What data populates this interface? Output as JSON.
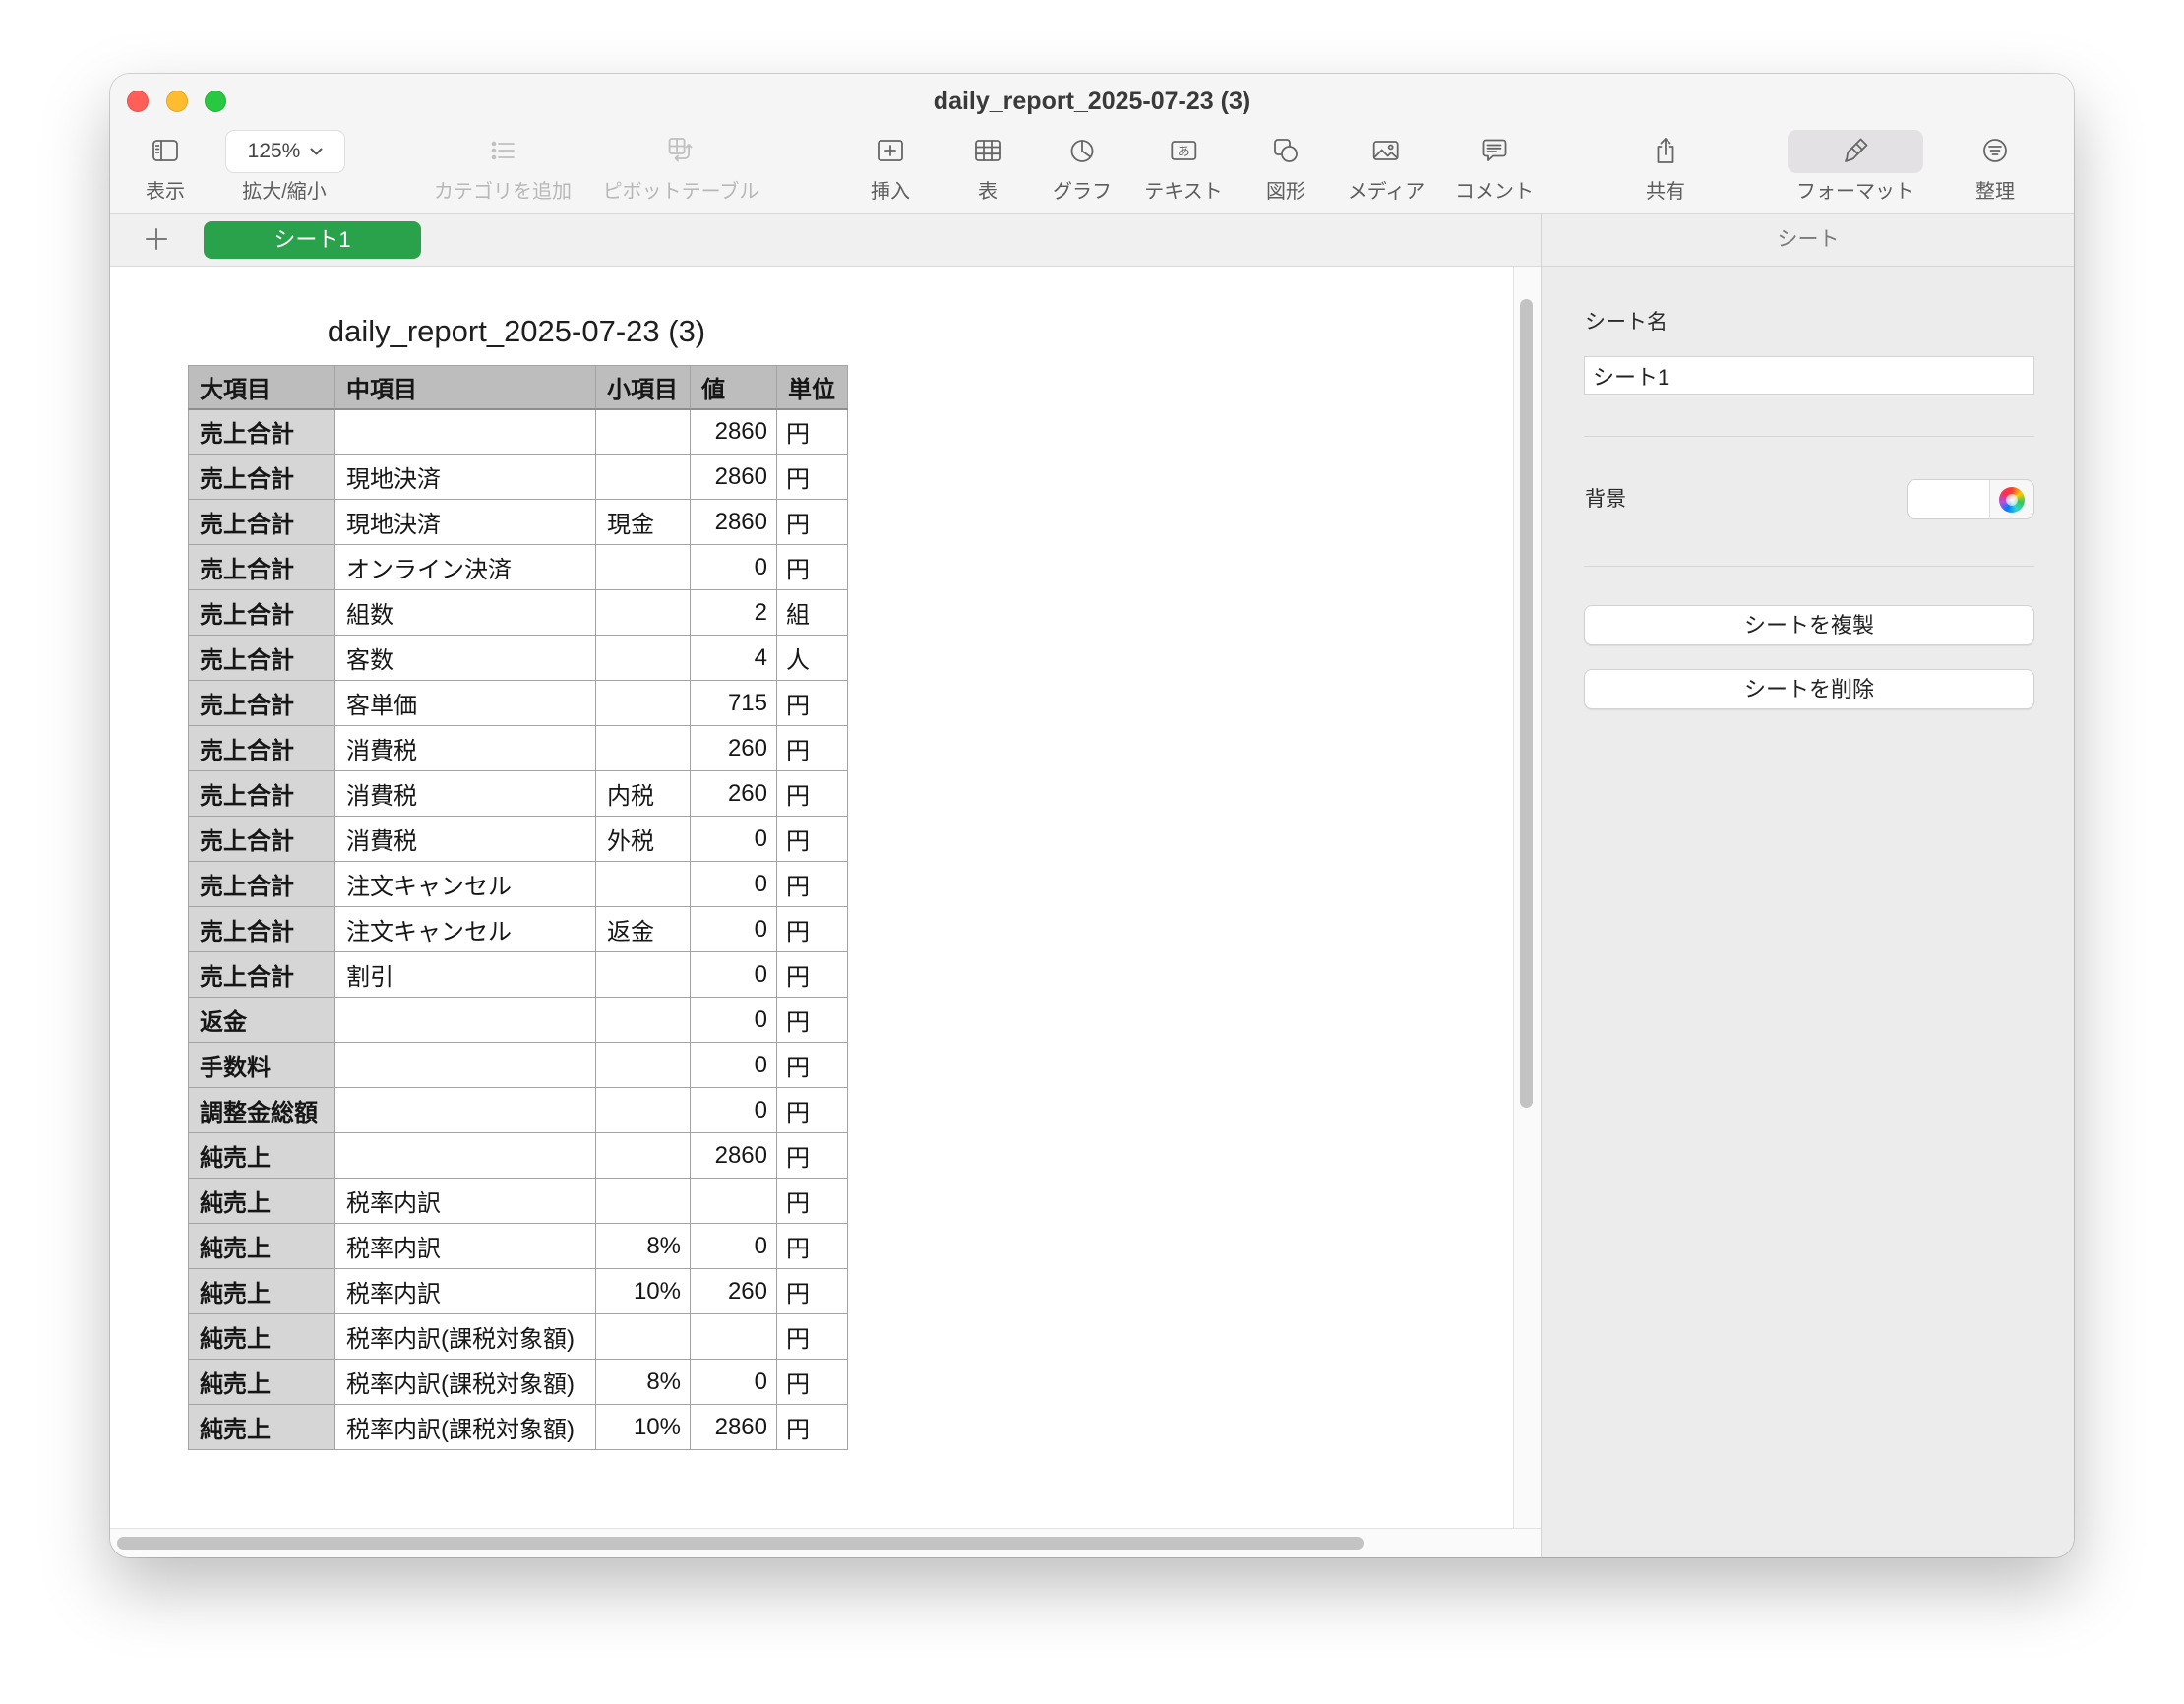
{
  "window": {
    "title": "daily_report_2025-07-23 (3)",
    "traffic_light_colors": {
      "close": "#ff5f57",
      "minimize": "#febc2e",
      "zoom": "#28c840"
    }
  },
  "toolbar": {
    "view": {
      "label": "表示",
      "icon": "sidebar-icon"
    },
    "zoom": {
      "value": "125%",
      "label": "拡大/縮小",
      "icon": "chevron-down-icon"
    },
    "add_category": {
      "label": "カテゴリを追加",
      "icon": "list-icon",
      "enabled": false
    },
    "pivot_table": {
      "label": "ピボットテーブル",
      "icon": "pivot-table-icon",
      "enabled": false
    },
    "insert": {
      "label": "挿入",
      "icon": "insert-icon"
    },
    "table": {
      "label": "表",
      "icon": "table-icon"
    },
    "chart": {
      "label": "グラフ",
      "icon": "chart-icon"
    },
    "text": {
      "label": "テキスト",
      "icon": "text-box-icon",
      "icon_glyph": "あ"
    },
    "shape": {
      "label": "図形",
      "icon": "shape-icon"
    },
    "media": {
      "label": "メディア",
      "icon": "media-icon"
    },
    "comment": {
      "label": "コメント",
      "icon": "comment-icon"
    },
    "share": {
      "label": "共有",
      "icon": "share-icon"
    },
    "format": {
      "label": "フォーマット",
      "icon": "paintbrush-icon",
      "selected": true
    },
    "organize": {
      "label": "整理",
      "icon": "organize-icon"
    }
  },
  "sheet_tabs": {
    "add_icon": "plus-icon",
    "tabs": [
      {
        "label": "シート1",
        "selected": true
      }
    ],
    "selected_color": "#2aa24b"
  },
  "inspector": {
    "tab_title": "シート",
    "sheet_name_label": "シート名",
    "sheet_name_value": "シート1",
    "background_label": "背景",
    "background_color": "#ffffff",
    "duplicate_button_label": "シートを複製",
    "delete_button_label": "シートを削除"
  },
  "table": {
    "title": "daily_report_2025-07-23 (3)",
    "header_color": "#bdbdbd",
    "row_header_color": "#d6d6d6",
    "headers": [
      "大項目",
      "中項目",
      "小項目",
      "値",
      "単位"
    ],
    "rows": [
      [
        "売上合計",
        "",
        "",
        "2860",
        "円"
      ],
      [
        "売上合計",
        "現地決済",
        "",
        "2860",
        "円"
      ],
      [
        "売上合計",
        "現地決済",
        "現金",
        "2860",
        "円"
      ],
      [
        "売上合計",
        "オンライン決済",
        "",
        "0",
        "円"
      ],
      [
        "売上合計",
        "組数",
        "",
        "2",
        "組"
      ],
      [
        "売上合計",
        "客数",
        "",
        "4",
        "人"
      ],
      [
        "売上合計",
        "客単価",
        "",
        "715",
        "円"
      ],
      [
        "売上合計",
        "消費税",
        "",
        "260",
        "円"
      ],
      [
        "売上合計",
        "消費税",
        "内税",
        "260",
        "円"
      ],
      [
        "売上合計",
        "消費税",
        "外税",
        "0",
        "円"
      ],
      [
        "売上合計",
        "注文キャンセル",
        "",
        "0",
        "円"
      ],
      [
        "売上合計",
        "注文キャンセル",
        "返金",
        "0",
        "円"
      ],
      [
        "売上合計",
        "割引",
        "",
        "0",
        "円"
      ],
      [
        "返金",
        "",
        "",
        "0",
        "円"
      ],
      [
        "手数料",
        "",
        "",
        "0",
        "円"
      ],
      [
        "調整金総額",
        "",
        "",
        "0",
        "円"
      ],
      [
        "純売上",
        "",
        "",
        "2860",
        "円"
      ],
      [
        "純売上",
        "税率内訳",
        "",
        "",
        "円"
      ],
      [
        "純売上",
        "税率内訳",
        "8%",
        "0",
        "円"
      ],
      [
        "純売上",
        "税率内訳",
        "10%",
        "260",
        "円"
      ],
      [
        "純売上",
        "税率内訳(課税対象額)",
        "",
        "",
        "円"
      ],
      [
        "純売上",
        "税率内訳(課税対象額)",
        "8%",
        "0",
        "円"
      ],
      [
        "純売上",
        "税率内訳(課税対象額)",
        "10%",
        "2860",
        "円"
      ]
    ]
  }
}
